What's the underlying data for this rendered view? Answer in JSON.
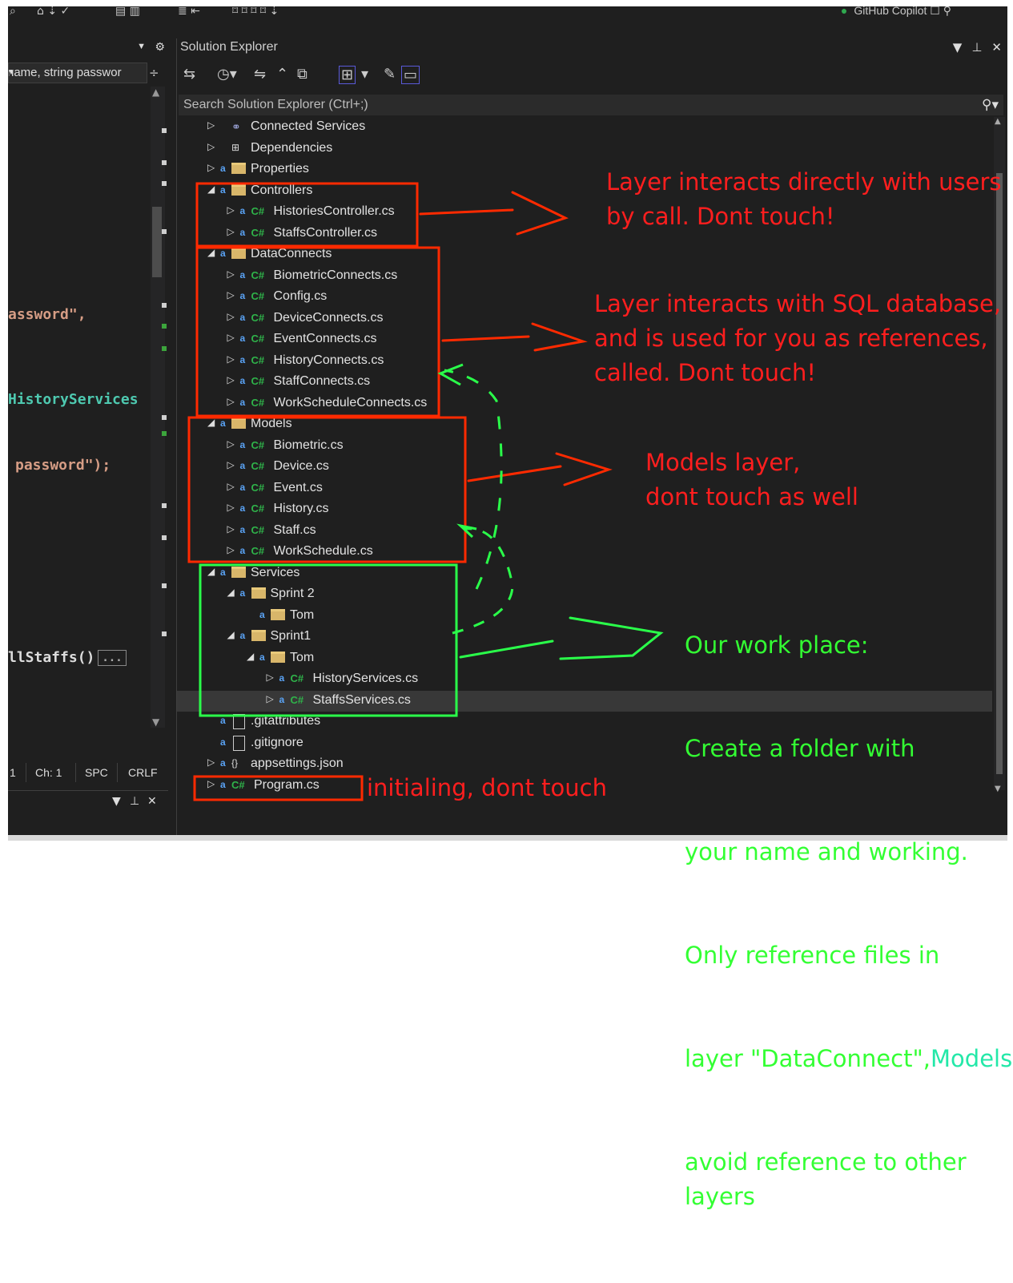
{
  "topbar": {
    "copilot_label": "GitHub Copilot"
  },
  "editor": {
    "method_dropdown": "name, string passwor",
    "code_lines": [
      {
        "t": "assword\",",
        "c": "str"
      },
      {
        "t": "HistoryServices",
        "c": "ty"
      },
      {
        "t": "password\");",
        "c": "str"
      },
      {
        "t": "llStaffs()",
        "c": "pl"
      }
    ],
    "ellipsis": "...",
    "status": {
      "line": "1",
      "ch": "Ch: 1",
      "spc": "SPC",
      "crlf": "CRLF"
    }
  },
  "solution_explorer": {
    "title": "Solution Explorer",
    "search_placeholder": "Search Solution Explorer (Ctrl+;)",
    "tree": [
      {
        "label": "Connected Services",
        "indent": 0,
        "expander": "collapsed",
        "icon": "connected-services-icon",
        "lock": false
      },
      {
        "label": "Dependencies",
        "indent": 0,
        "expander": "collapsed",
        "icon": "dependencies-icon",
        "lock": false
      },
      {
        "label": "Properties",
        "indent": 0,
        "expander": "collapsed",
        "icon": "properties-icon",
        "lock": true
      },
      {
        "label": "Controllers",
        "indent": 0,
        "expander": "expanded",
        "icon": "folder-icon",
        "lock": true
      },
      {
        "label": "HistoriesController.cs",
        "indent": 1,
        "expander": "collapsed",
        "icon": "csharp-icon",
        "lock": true
      },
      {
        "label": "StaffsController.cs",
        "indent": 1,
        "expander": "collapsed",
        "icon": "csharp-icon",
        "lock": true
      },
      {
        "label": "DataConnects",
        "indent": 0,
        "expander": "expanded",
        "icon": "folder-icon",
        "lock": true
      },
      {
        "label": "BiometricConnects.cs",
        "indent": 1,
        "expander": "collapsed",
        "icon": "csharp-icon",
        "lock": true
      },
      {
        "label": "Config.cs",
        "indent": 1,
        "expander": "collapsed",
        "icon": "csharp-icon",
        "lock": true
      },
      {
        "label": "DeviceConnects.cs",
        "indent": 1,
        "expander": "collapsed",
        "icon": "csharp-icon",
        "lock": true
      },
      {
        "label": "EventConnects.cs",
        "indent": 1,
        "expander": "collapsed",
        "icon": "csharp-icon",
        "lock": true
      },
      {
        "label": "HistoryConnects.cs",
        "indent": 1,
        "expander": "collapsed",
        "icon": "csharp-icon",
        "lock": true
      },
      {
        "label": "StaffConnects.cs",
        "indent": 1,
        "expander": "collapsed",
        "icon": "csharp-icon",
        "lock": true
      },
      {
        "label": "WorkScheduleConnects.cs",
        "indent": 1,
        "expander": "collapsed",
        "icon": "csharp-icon",
        "lock": true
      },
      {
        "label": "Models",
        "indent": 0,
        "expander": "expanded",
        "icon": "folder-icon",
        "lock": true
      },
      {
        "label": "Biometric.cs",
        "indent": 1,
        "expander": "collapsed",
        "icon": "csharp-icon",
        "lock": true
      },
      {
        "label": "Device.cs",
        "indent": 1,
        "expander": "collapsed",
        "icon": "csharp-icon",
        "lock": true
      },
      {
        "label": "Event.cs",
        "indent": 1,
        "expander": "collapsed",
        "icon": "csharp-icon",
        "lock": true
      },
      {
        "label": "History.cs",
        "indent": 1,
        "expander": "collapsed",
        "icon": "csharp-icon",
        "lock": true
      },
      {
        "label": "Staff.cs",
        "indent": 1,
        "expander": "collapsed",
        "icon": "csharp-icon",
        "lock": true
      },
      {
        "label": "WorkSchedule.cs",
        "indent": 1,
        "expander": "collapsed",
        "icon": "csharp-icon",
        "lock": true
      },
      {
        "label": "Services",
        "indent": 0,
        "expander": "expanded",
        "icon": "folder-icon",
        "lock": true
      },
      {
        "label": "Sprint 2",
        "indent": 1,
        "expander": "expanded",
        "icon": "folder-icon",
        "lock": true
      },
      {
        "label": "Tom",
        "indent": 2,
        "expander": "none",
        "icon": "folder-icon",
        "lock": true
      },
      {
        "label": "Sprint1",
        "indent": 1,
        "expander": "expanded",
        "icon": "folder-icon",
        "lock": true
      },
      {
        "label": "Tom",
        "indent": 2,
        "expander": "expanded",
        "icon": "folder-icon",
        "lock": true
      },
      {
        "label": "HistoryServices.cs",
        "indent": 3,
        "expander": "collapsed",
        "icon": "csharp-icon",
        "lock": true
      },
      {
        "label": "StaffsServices.cs",
        "indent": 3,
        "expander": "collapsed",
        "icon": "csharp-icon",
        "lock": true,
        "selected": true
      },
      {
        "label": ".gitattributes",
        "indent": 0,
        "expander": "none",
        "icon": "file-icon",
        "lock": true
      },
      {
        "label": ".gitignore",
        "indent": 0,
        "expander": "none",
        "icon": "file-icon",
        "lock": true
      },
      {
        "label": "appsettings.json",
        "indent": 0,
        "expander": "collapsed",
        "icon": "json-icon",
        "lock": true
      },
      {
        "label": "Program.cs",
        "indent": 0,
        "expander": "collapsed",
        "icon": "csharp-icon",
        "lock": true
      }
    ]
  },
  "annotations": {
    "controllers": "Layer interacts directly with users\nby call. Dont touch!",
    "dataconnects": "Layer interacts with SQL database,\nand is used for you as references,\ncalled. Dont touch!",
    "models": "Models layer,\ndont touch as well",
    "services_lines": [
      "Our work place:",
      "Create a folder with",
      "your name and working.",
      "Only reference files in"
    ],
    "services_layer_prefix": "layer \"DataConnect\",",
    "services_layer_models": "Models",
    "services_tail": "avoid reference to other\nlayers",
    "program": "initialing, dont touch"
  },
  "colors": {
    "annotation_red": "#ff1e1e",
    "annotation_green": "#33ff33",
    "csharp_green": "#2fb34a",
    "lock_blue": "#5aa3f5",
    "folder_tan": "#d8b66a"
  }
}
